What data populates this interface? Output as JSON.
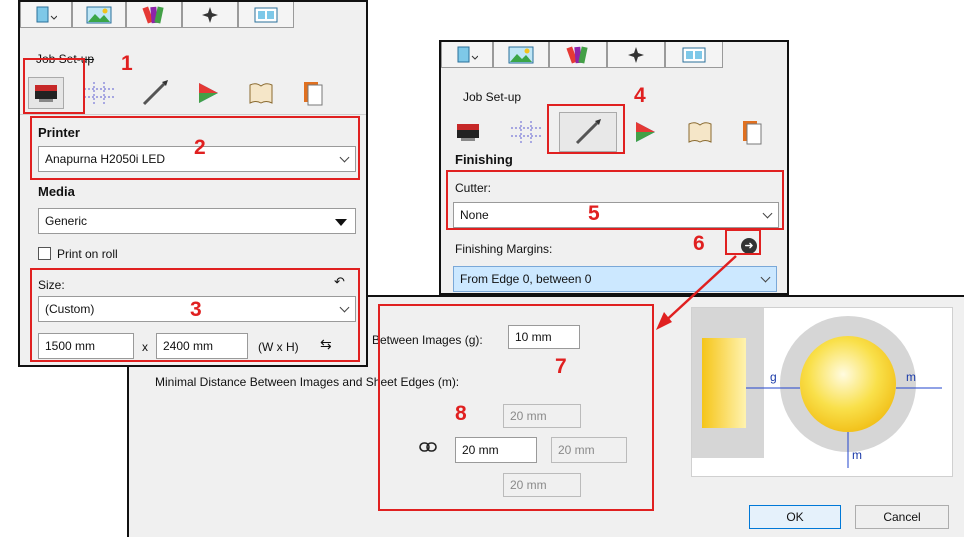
{
  "left_panel": {
    "job_setup_label": "Job Set-up",
    "printer_header": "Printer",
    "printer_value": "Anapurna H2050i LED",
    "media_header": "Media",
    "media_value": "Generic",
    "print_on_roll_label": "Print on roll",
    "size_label": "Size:",
    "size_value": "(Custom)",
    "width_value": "1500 mm",
    "x_label": "x",
    "height_value": "2400 mm",
    "wxh_label": "(W x H)"
  },
  "right_panel": {
    "job_setup_label": "Job Set-up",
    "finishing_header": "Finishing",
    "cutter_label": "Cutter:",
    "cutter_value": "None",
    "finishing_margins_label": "Finishing Margins:",
    "finishing_margins_value": "From Edge 0, between 0"
  },
  "dialog": {
    "between_images_label": "Between Images (g):",
    "between_images_value": "10 mm",
    "edges_label": "Minimal Distance Between Images and Sheet Edges (m):",
    "top_value": "20 mm",
    "left_value": "20 mm",
    "right_value": "20 mm",
    "bottom_value": "20 mm",
    "diagram_g": "g",
    "diagram_m_right": "m",
    "diagram_m_bottom": "m",
    "ok_label": "OK",
    "cancel_label": "Cancel"
  },
  "callouts": {
    "n1": "1",
    "n2": "2",
    "n3": "3",
    "n4": "4",
    "n5": "5",
    "n6": "6",
    "n7": "7",
    "n8": "8"
  },
  "colors": {
    "callout_red": "#e02020",
    "selection_blue": "#cce8ff",
    "accent_blue": "#0078d7",
    "sphere_yellow": "#f4d630"
  }
}
